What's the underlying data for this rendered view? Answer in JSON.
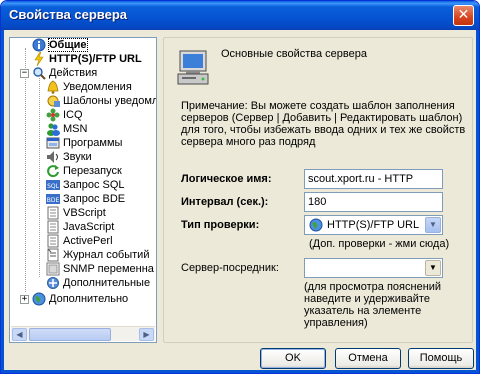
{
  "window": {
    "title": "Свойства сервера",
    "close_glyph": "✕"
  },
  "tree": {
    "items": [
      {
        "label": "Общие",
        "icon": "info-icon",
        "bold": true
      },
      {
        "label": "HTTP(S)/FTP URL",
        "icon": "lightning-icon",
        "bold": true
      },
      {
        "label": "Действия",
        "icon": "magnifier-icon",
        "bold": false
      },
      {
        "label": "Уведомления",
        "icon": "bell-icon",
        "bold": false
      },
      {
        "label": "Шаблоны уведомл",
        "icon": "template-icon",
        "bold": false
      },
      {
        "label": "ICQ",
        "icon": "icq-flower-icon",
        "bold": false
      },
      {
        "label": "MSN",
        "icon": "msn-icon",
        "bold": false
      },
      {
        "label": "Программы",
        "icon": "program-icon",
        "bold": false
      },
      {
        "label": "Звуки",
        "icon": "sound-icon",
        "bold": false
      },
      {
        "label": "Перезапуск",
        "icon": "restart-icon",
        "bold": false
      },
      {
        "label": "Запрос SQL",
        "icon": "sql-icon",
        "bold": false
      },
      {
        "label": "Запрос BDE",
        "icon": "bde-icon",
        "bold": false
      },
      {
        "label": "VBScript",
        "icon": "script-icon",
        "bold": false
      },
      {
        "label": "JavaScript",
        "icon": "script-icon",
        "bold": false
      },
      {
        "label": "ActivePerl",
        "icon": "script-icon",
        "bold": false
      },
      {
        "label": "Журнал событий",
        "icon": "log-icon",
        "bold": false
      },
      {
        "label": "SNMP переменна",
        "icon": "snmp-icon",
        "bold": false
      },
      {
        "label": "Дополнительные",
        "icon": "extra-icon",
        "bold": false
      },
      {
        "label": "Дополнительно",
        "icon": "globe-icon",
        "bold": false
      }
    ]
  },
  "main": {
    "section_title": "Основные свойства сервера",
    "note": "Примечание: Вы можете создать шаблон заполнения серверов (Сервер | Добавить | Редактировать шаблон) для того, чтобы избежать ввода одних и тех же свойств сервера много раз подряд",
    "logical_name_label": "Логическое имя:",
    "logical_name_value": "scout.xport.ru - HTTP",
    "interval_label": "Интервал (сек.):",
    "interval_value": "180",
    "check_type_label": "Тип проверки:",
    "check_type_value": "HTTP(S)/FTP URL",
    "check_type_hint": "(Доп. проверки - жми сюда)",
    "proxy_label": "Сервер-посредник:",
    "proxy_value": "",
    "proxy_hint": "(для просмотра пояснений наведите и удерживайте указатель на элементе управления)"
  },
  "buttons": {
    "ok": "OK",
    "cancel": "Отмена",
    "help": "Помощь"
  },
  "colors": {
    "title_blue": "#0553d1",
    "border_blue": "#7f9db9",
    "face": "#ece9d8"
  }
}
